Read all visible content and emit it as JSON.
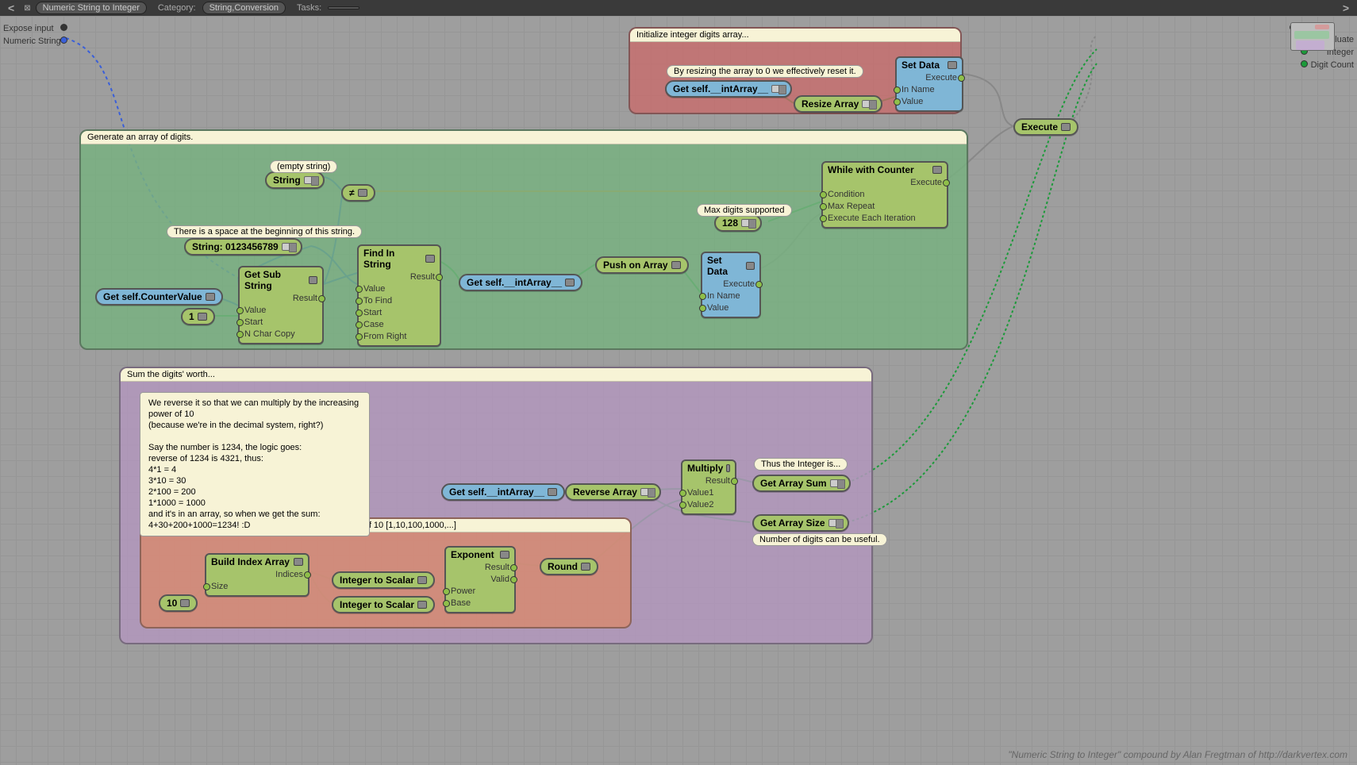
{
  "topbar": {
    "name": "Numeric String to Integer",
    "category_label": "Category:",
    "category": "String,Conversion",
    "tasks_label": "Tasks:"
  },
  "inputs": {
    "expose": "Expose input",
    "numeric": "Numeric String"
  },
  "outputs": {
    "evaluate": "Evaluate",
    "integer": "Integer",
    "digitcount": "Digit Count"
  },
  "group_init": {
    "title": "Initialize integer digits array..."
  },
  "group_gen": {
    "title": "Generate an array of digits."
  },
  "group_sum": {
    "title": "Sum the digits' worth..."
  },
  "group_pow": {
    "title": "Generate an array of integers for the increasing powers of 10  [1,10,100,1000,...]"
  },
  "tooltips": {
    "reset": "By resizing the array to 0 we effectively reset it.",
    "empty": "(empty string)",
    "space": "There is a space at the beginning of this string.",
    "maxdigits": "Max digits supported",
    "thusint": "Thus the Integer is...",
    "numdigits": "Number of digits can be useful."
  },
  "note": "We reverse it so that we can multiply by the increasing power of 10\n(because we're in the decimal system, right?)\n\nSay the number is 1234, the logic goes:\nreverse of 1234 is 4321, thus:\n4*1 = 4\n3*10 = 30\n2*100 = 200\n1*1000 = 1000\nand it's in an array, so when we get the sum:\n4+30+200+1000=1234! :D",
  "pills": {
    "getint1": "Get self.__intArray__",
    "resize": "Resize Array",
    "string": "String",
    "neq": "≠",
    "str0123": "String:  0123456789",
    "counter": "Get self.CounterValue",
    "one": "1",
    "getint2": "Get self.__intArray__",
    "push": "Push on Array",
    "n128": "128",
    "getint3": "Get self.__intArray__",
    "reverse": "Reverse Array",
    "getsum": "Get Array Sum",
    "getsize": "Get Array Size",
    "ten": "10",
    "int2sc1": "Integer to Scalar",
    "int2sc2": "Integer to Scalar",
    "round": "Round",
    "execute": "Execute"
  },
  "nodes": {
    "setdata1": {
      "title": "Set Data",
      "out": "Execute",
      "p1": "In Name",
      "p2": "Value"
    },
    "while": {
      "title": "While with Counter",
      "out": "Execute",
      "p1": "Condition",
      "p2": "Max Repeat",
      "p3": "Execute Each Iteration"
    },
    "setdata2": {
      "title": "Set Data",
      "out": "Execute",
      "p1": "In Name",
      "p2": "Value"
    },
    "getsub": {
      "title": "Get Sub String",
      "out": "Result",
      "p1": "Value",
      "p2": "Start",
      "p3": "N Char Copy"
    },
    "find": {
      "title": "Find In String",
      "out": "Result",
      "p1": "Value",
      "p2": "To Find",
      "p3": "Start",
      "p4": "Case",
      "p5": "From Right"
    },
    "multiply": {
      "title": "Multiply",
      "out": "Result",
      "p1": "Value1",
      "p2": "Value2"
    },
    "build": {
      "title": "Build Index Array",
      "out": "Indices",
      "p1": "Size"
    },
    "exp": {
      "title": "Exponent",
      "out1": "Result",
      "out2": "Valid",
      "p1": "Power",
      "p2": "Base"
    }
  },
  "credit": "\"Numeric String to Integer\" compound by Alan Fregtman of http://darkvertex.com"
}
